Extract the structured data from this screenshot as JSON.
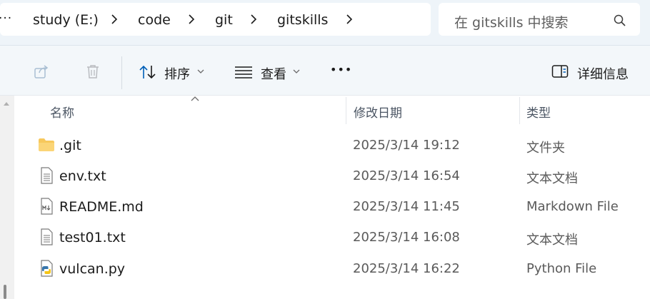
{
  "address": {
    "overflow": "···",
    "crumbs": [
      "study (E:)",
      "code",
      "git",
      "gitskills"
    ]
  },
  "search": {
    "placeholder": "在 gitskills 中搜索"
  },
  "toolbar": {
    "sort_label": "排序",
    "view_label": "查看",
    "more_label": "•••",
    "details_label": "详细信息"
  },
  "columns": {
    "name": "名称",
    "date": "修改日期",
    "type": "类型"
  },
  "files": [
    {
      "name": ".git",
      "date": "2025/3/14 19:12",
      "type": "文件夹",
      "icon": "folder-icon"
    },
    {
      "name": "env.txt",
      "date": "2025/3/14 16:54",
      "type": "文本文档",
      "icon": "text-file-icon"
    },
    {
      "name": "README.md",
      "date": "2025/3/14 11:45",
      "type": "Markdown File",
      "icon": "markdown-file-icon"
    },
    {
      "name": "test01.txt",
      "date": "2025/3/14 16:08",
      "type": "文本文档",
      "icon": "text-file-icon"
    },
    {
      "name": "vulcan.py",
      "date": "2025/3/14 16:22",
      "type": "Python File",
      "icon": "python-file-icon"
    }
  ],
  "colors": {
    "address_bg": "#eef4f9",
    "toolbar_bg": "#f3f7fa",
    "accent": "#005fb8",
    "folder": "#f7c85c"
  }
}
